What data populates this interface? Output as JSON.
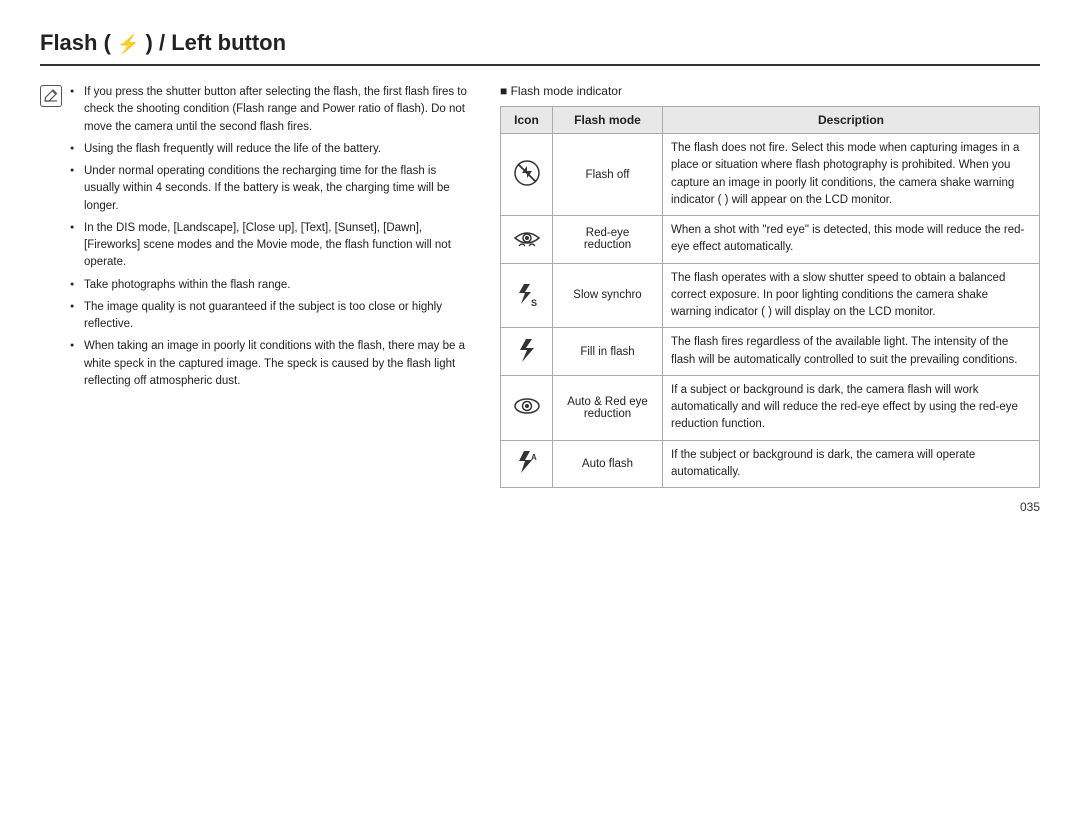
{
  "title": "Flash (  ) / Left button",
  "title_display": "Flash ( ⚡ ) / Left button",
  "note_icon": "✎",
  "note_bullets": [
    "If you press the shutter button after selecting the flash, the first flash fires to check the shooting condition (Flash range and Power ratio of flash). Do not move the camera until the second flash fires.",
    "Using the flash frequently will reduce the life of the battery.",
    "Under normal operating conditions the recharging time for the flash is usually within 4 seconds. If the battery is weak, the charging time will be longer.",
    "In the DIS mode, [Landscape], [Close up], [Text], [Sunset], [Dawn], [Fireworks] scene modes and the Movie mode, the flash function will not operate.",
    "Take photographs within the flash range.",
    "The image quality is not guaranteed if the subject is too close or highly reflective.",
    "When taking an image in poorly lit conditions with the flash, there may be a white speck in the captured image. The speck is caused by the flash light reflecting off atmospheric dust."
  ],
  "indicator_title": "Flash mode indicator",
  "table": {
    "headers": [
      "Icon",
      "Flash mode",
      "Description"
    ],
    "rows": [
      {
        "icon": "flash_off",
        "mode": "Flash off",
        "description": "The flash does not fire. Select this mode when capturing images in a place or situation where flash photography is prohibited. When you capture an image in poorly lit conditions, the camera shake warning indicator ( ) will appear on the LCD monitor."
      },
      {
        "icon": "red_eye",
        "mode": "Red-eye reduction",
        "description": "When a shot with \"red eye\" is detected, this mode will reduce the red-eye effect automatically."
      },
      {
        "icon": "slow_synchro",
        "mode": "Slow synchro",
        "description": "The flash operates with a slow shutter speed to obtain a balanced correct exposure. In poor lighting conditions the camera shake warning indicator ( ) will display on the LCD monitor."
      },
      {
        "icon": "fill_flash",
        "mode": "Fill in flash",
        "description": "The flash fires regardless of the available light. The intensity of the flash will be automatically controlled to suit the prevailing conditions."
      },
      {
        "icon": "auto_red_eye",
        "mode": "Auto & Red eye reduction",
        "description": "If a subject or background is dark, the camera flash will work automatically and will reduce the red-eye effect by using the red-eye reduction function."
      },
      {
        "icon": "auto_flash",
        "mode": "Auto flash",
        "description": "If the subject or background is dark, the camera will operate automatically."
      }
    ]
  },
  "page_number": "035"
}
